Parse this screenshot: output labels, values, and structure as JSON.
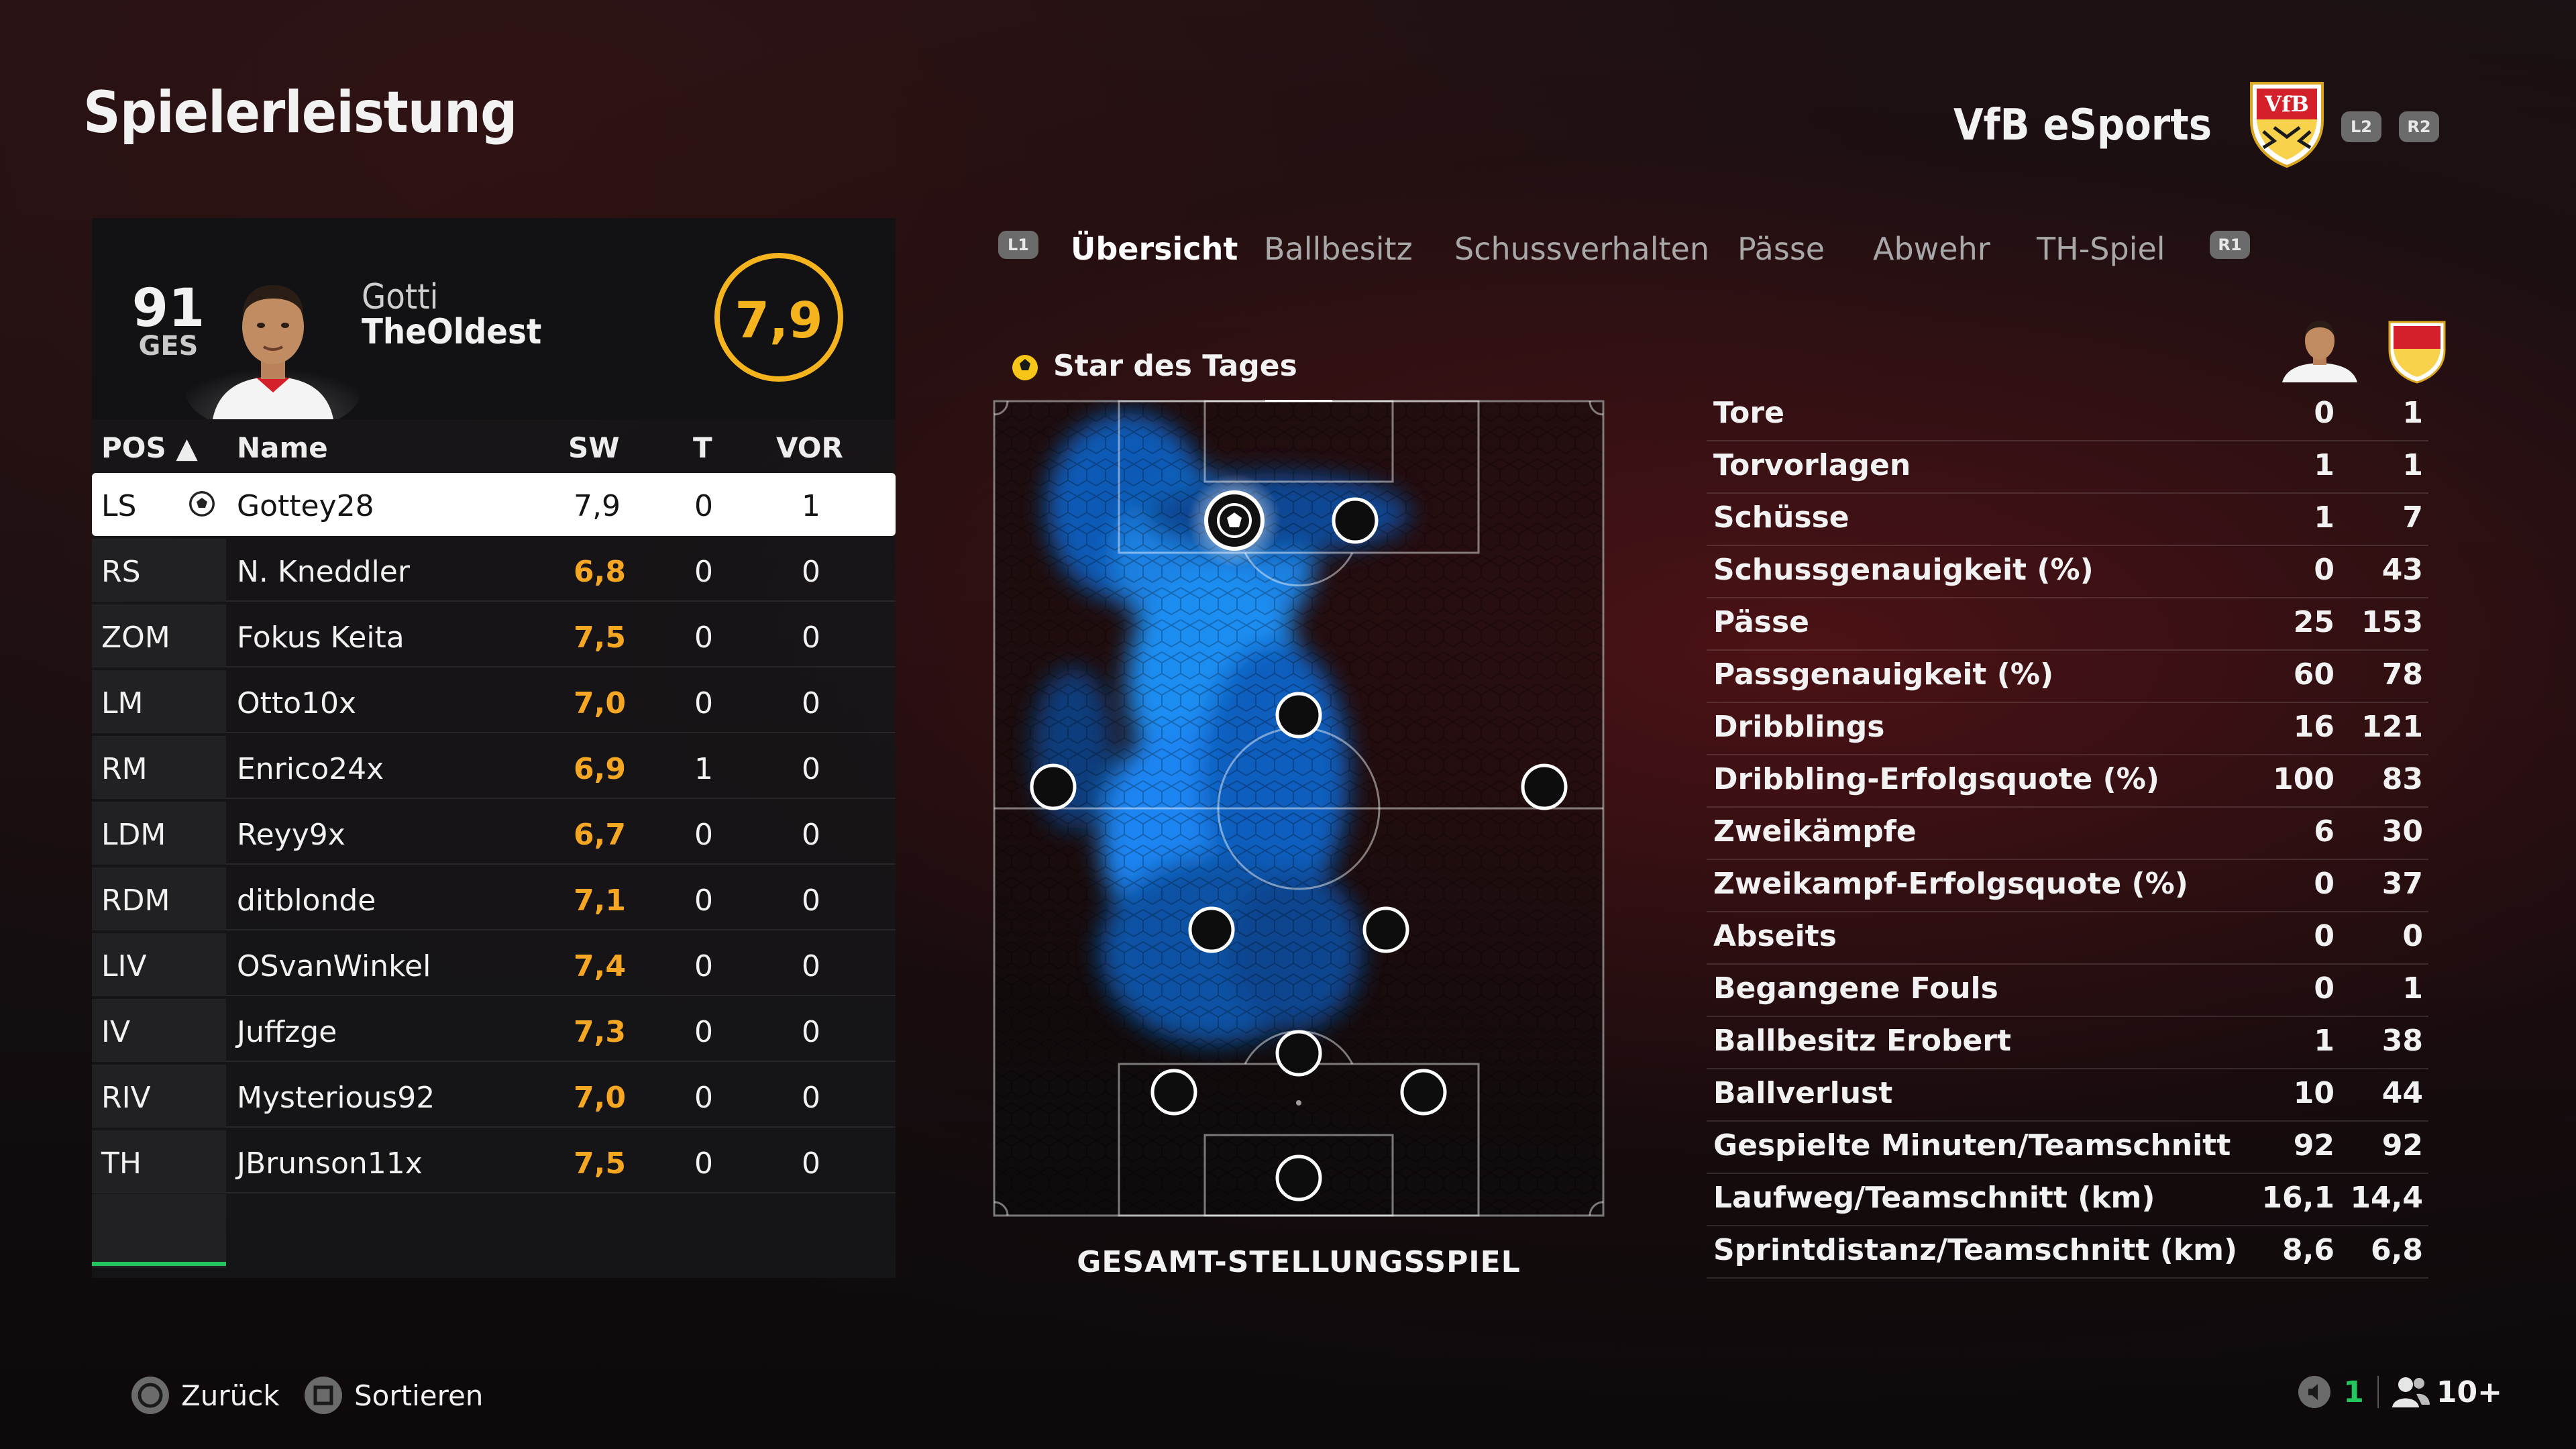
{
  "header": {
    "title": "Spielerleistung",
    "team": "VfB eSports",
    "crest_text": "VfB",
    "l2": "L2",
    "r2": "R2"
  },
  "player_card": {
    "overall": "91",
    "overall_label": "GES",
    "first_name": "Gotti",
    "last_name": "TheOldest",
    "rating": "7,9"
  },
  "table": {
    "headers": {
      "pos": "POS ▲",
      "name": "Name",
      "rating": "SW",
      "goals": "T",
      "assists": "VOR"
    },
    "rows": [
      {
        "pos": "LS",
        "name": "Gottey28",
        "rating": "7,9",
        "goals": "0",
        "assists": "1",
        "selected": true
      },
      {
        "pos": "RS",
        "name": "N. Kneddler",
        "rating": "6,8",
        "goals": "0",
        "assists": "0"
      },
      {
        "pos": "ZOM",
        "name": "Fokus Keita",
        "rating": "7,5",
        "goals": "0",
        "assists": "0"
      },
      {
        "pos": "LM",
        "name": "Otto10x",
        "rating": "7,0",
        "goals": "0",
        "assists": "0"
      },
      {
        "pos": "RM",
        "name": "Enrico24x",
        "rating": "6,9",
        "goals": "1",
        "assists": "0"
      },
      {
        "pos": "LDM",
        "name": "Reyy9x",
        "rating": "6,7",
        "goals": "0",
        "assists": "0"
      },
      {
        "pos": "RDM",
        "name": "ditblonde",
        "rating": "7,1",
        "goals": "0",
        "assists": "0"
      },
      {
        "pos": "LIV",
        "name": "OSvanWinkel",
        "rating": "7,4",
        "goals": "0",
        "assists": "0"
      },
      {
        "pos": "IV",
        "name": "Juffzge",
        "rating": "7,3",
        "goals": "0",
        "assists": "0"
      },
      {
        "pos": "RIV",
        "name": "Mysterious92",
        "rating": "7,0",
        "goals": "0",
        "assists": "0"
      },
      {
        "pos": "TH",
        "name": "JBrunson11x",
        "rating": "7,5",
        "goals": "0",
        "assists": "0"
      }
    ]
  },
  "tabs": {
    "l1": "L1",
    "r1": "R1",
    "items": [
      "Übersicht",
      "Ballbesitz",
      "Schussverhalten",
      "Pässe",
      "Abwehr",
      "TH-Spiel"
    ],
    "active": "Übersicht"
  },
  "pitch": {
    "star_label": "Star des Tages",
    "caption": "GESAMT-STELLUNGSSPIEL"
  },
  "stats": [
    {
      "label": "Tore",
      "player": "0",
      "team": "1"
    },
    {
      "label": "Torvorlagen",
      "player": "1",
      "team": "1"
    },
    {
      "label": "Schüsse",
      "player": "1",
      "team": "7"
    },
    {
      "label": "Schussgenauigkeit (%)",
      "player": "0",
      "team": "43"
    },
    {
      "label": "Pässe",
      "player": "25",
      "team": "153"
    },
    {
      "label": "Passgenauigkeit (%)",
      "player": "60",
      "team": "78"
    },
    {
      "label": "Dribblings",
      "player": "16",
      "team": "121"
    },
    {
      "label": "Dribbling-Erfolgsquote (%)",
      "player": "100",
      "team": "83"
    },
    {
      "label": "Zweikämpfe",
      "player": "6",
      "team": "30"
    },
    {
      "label": "Zweikampf-Erfolgsquote (%)",
      "player": "0",
      "team": "37"
    },
    {
      "label": "Abseits",
      "player": "0",
      "team": "0"
    },
    {
      "label": "Begangene Fouls",
      "player": "0",
      "team": "1"
    },
    {
      "label": "Ballbesitz Erobert",
      "player": "1",
      "team": "38"
    },
    {
      "label": "Ballverlust",
      "player": "10",
      "team": "44"
    },
    {
      "label": "Gespielte Minuten/Teamschnitt",
      "player": "92",
      "team": "92"
    },
    {
      "label": "Laufweg/Teamschnitt (km)",
      "player": "16,1",
      "team": "14,4"
    },
    {
      "label": "Sprintdistanz/Teamschnitt (km)",
      "player": "8,6",
      "team": "6,8"
    }
  ],
  "footer": {
    "back": "Zurück",
    "sort": "Sortieren",
    "count1": "1",
    "count2": "10+"
  },
  "colors": {
    "rating_gold": "#f5b31e",
    "rating_orange": "#f5a623",
    "heat": "#1a8cff",
    "accent_green": "#22c55e",
    "crest_red": "#d4202a"
  }
}
